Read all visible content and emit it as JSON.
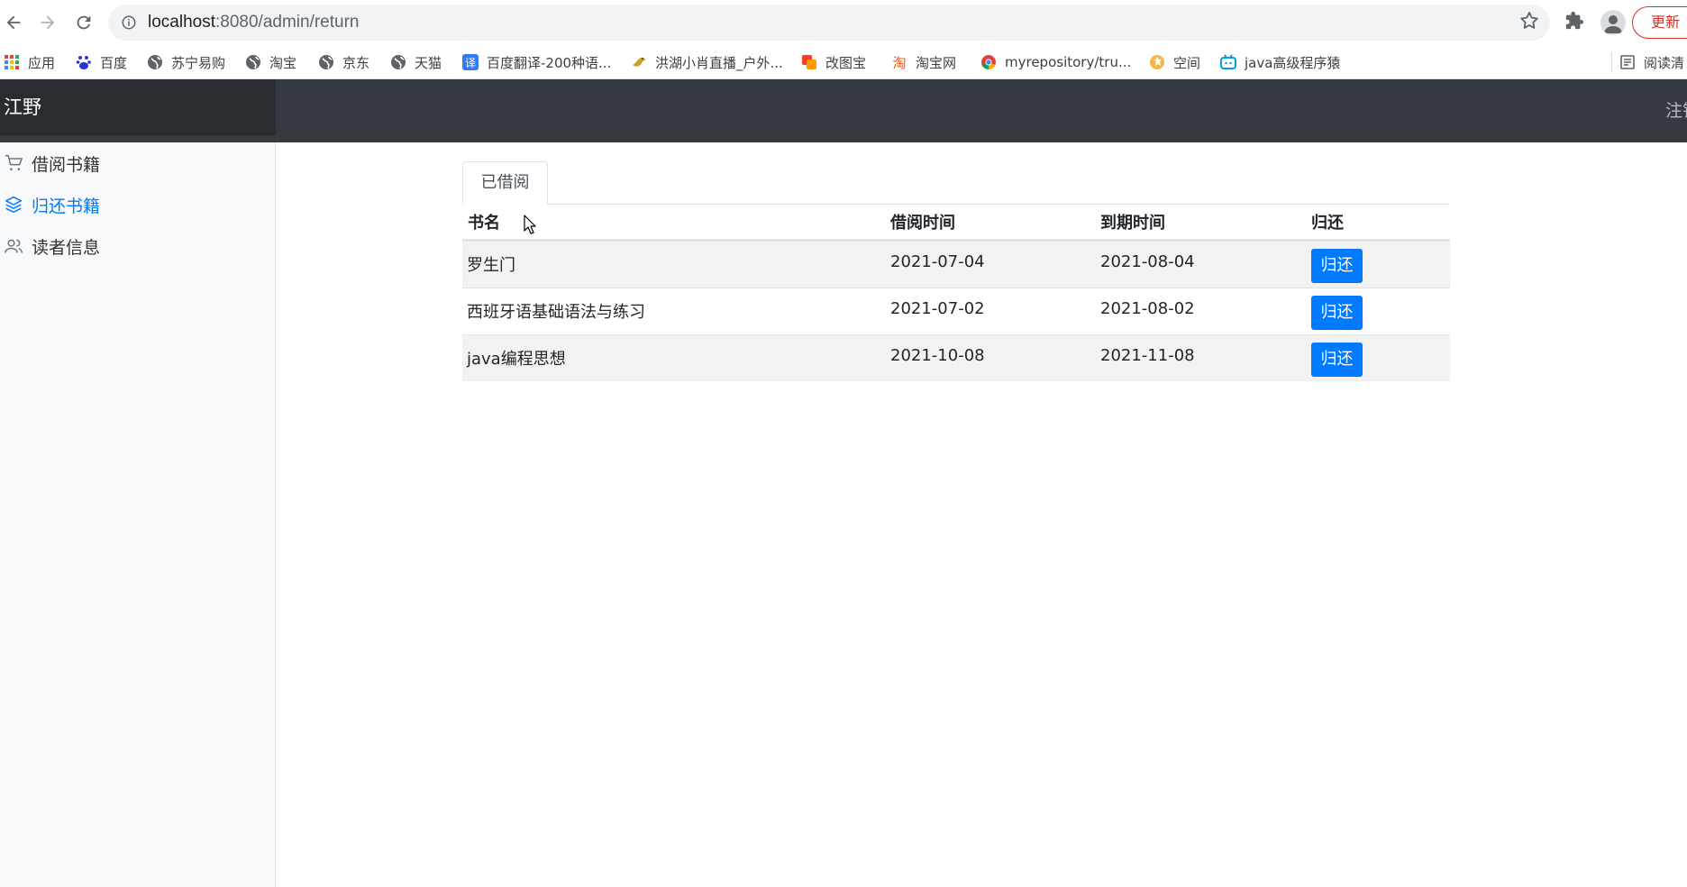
{
  "browser": {
    "url_host": "localhost",
    "url_path": ":8080/admin/return",
    "update_label": "更新",
    "bookmarks": [
      {
        "label": "应用",
        "icon": "apps-grid-icon"
      },
      {
        "label": "百度",
        "icon": "baidu-paw-icon"
      },
      {
        "label": "苏宁易购",
        "icon": "globe-icon"
      },
      {
        "label": "淘宝",
        "icon": "globe-icon"
      },
      {
        "label": "京东",
        "icon": "globe-icon"
      },
      {
        "label": "天猫",
        "icon": "globe-icon"
      },
      {
        "label": "百度翻译-200种语...",
        "icon": "translate-icon"
      },
      {
        "label": "洪湖小肖直播_户外...",
        "icon": "bird-icon"
      },
      {
        "label": "改图宝",
        "icon": "square-orange-icon"
      },
      {
        "label": "淘宝网",
        "icon": "taobao-icon"
      },
      {
        "label": "myrepository/tru...",
        "icon": "chrome-icon"
      },
      {
        "label": "空间",
        "icon": "qzone-icon"
      },
      {
        "label": "java高级程序猿",
        "icon": "bilibili-icon"
      },
      {
        "label": "阅读清",
        "icon": "reading-list-icon"
      }
    ]
  },
  "app": {
    "brand": "江野",
    "logout": "注销",
    "sidebar": [
      {
        "label": "借阅书籍",
        "icon": "cart-icon",
        "active": false
      },
      {
        "label": "归还书籍",
        "icon": "layers-icon",
        "active": true
      },
      {
        "label": "读者信息",
        "icon": "users-icon",
        "active": false
      }
    ],
    "tab_label": "已借阅",
    "table": {
      "headers": [
        "书名",
        "借阅时间",
        "到期时间",
        "归还"
      ],
      "rows": [
        {
          "name": "罗生门",
          "borrow": "2021-07-04",
          "due": "2021-08-04",
          "action": "归还"
        },
        {
          "name": "西班牙语基础语法与练习",
          "borrow": "2021-07-02",
          "due": "2021-08-02",
          "action": "归还"
        },
        {
          "name": "java编程思想",
          "borrow": "2021-10-08",
          "due": "2021-11-08",
          "action": "归还"
        }
      ]
    }
  },
  "colors": {
    "topnav": "#343a40",
    "brand_bg": "#292d32",
    "accent": "#007bff",
    "update_red": "#d93025"
  }
}
